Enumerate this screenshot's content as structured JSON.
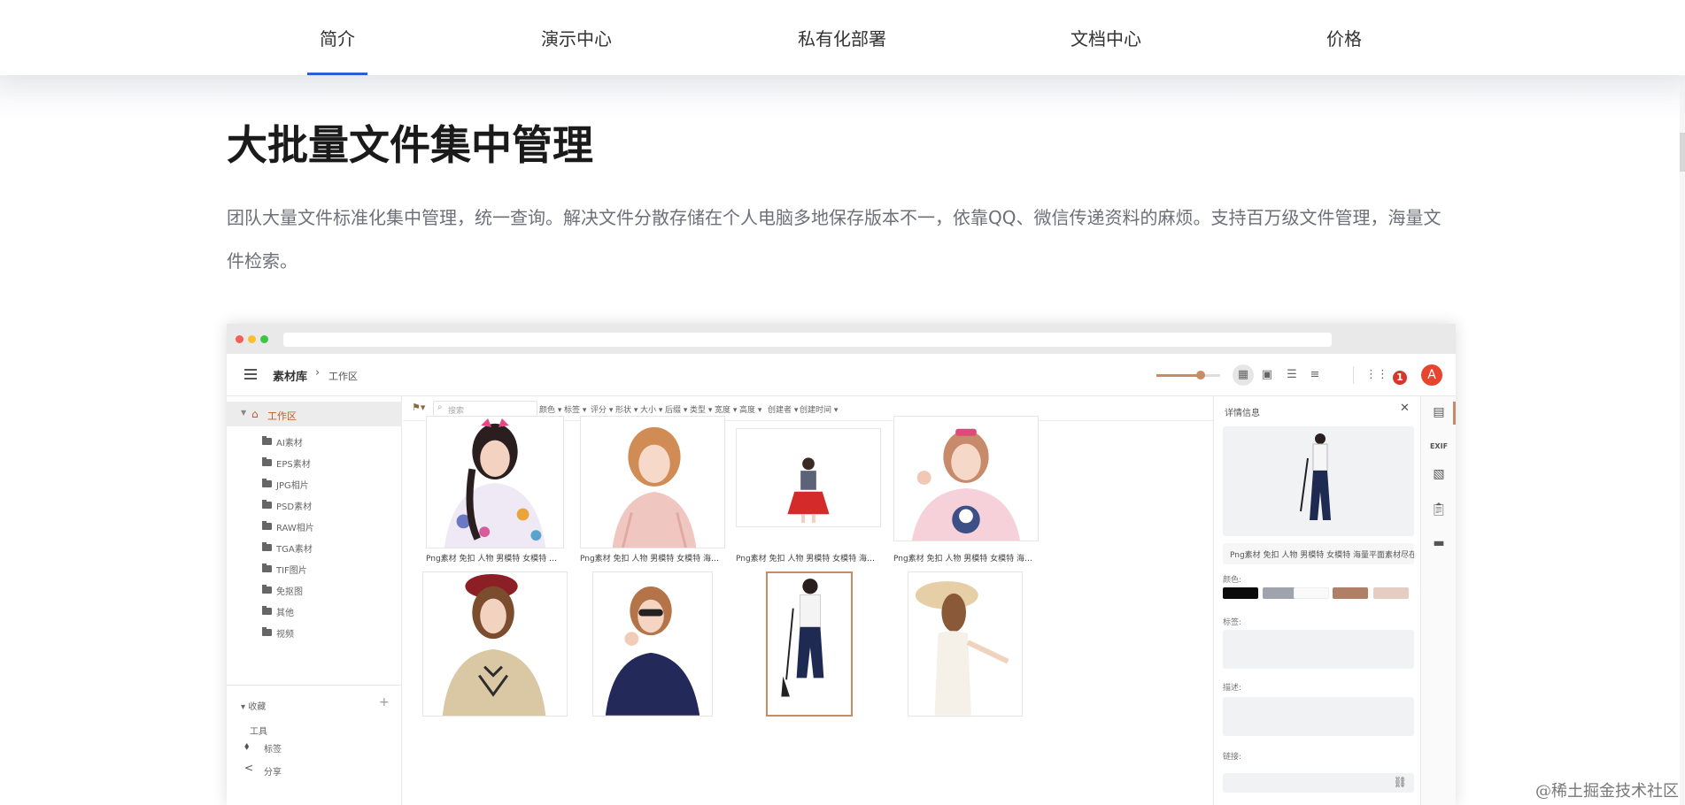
{
  "nav": {
    "items": [
      "简介",
      "演示中心",
      "私有化部署",
      "文档中心",
      "价格"
    ],
    "active_index": 0
  },
  "hero": {
    "title": "大批量文件集中管理",
    "description": "团队大量文件标准化集中管理，统一查询。解决文件分散存储在个人电脑多地保存版本不一，依靠QQ、微信传递资料的麻烦。支持百万级文件管理，海量文件检索。"
  },
  "app": {
    "breadcrumb": {
      "root": "素材库",
      "separator": "›",
      "current": "工作区"
    },
    "notification_count": "1",
    "avatar_initial": "A",
    "thumbnail_size_level": 0.7,
    "sidebar": {
      "root_label": "工作区",
      "folders": [
        "AI素材",
        "EPS素材",
        "JPG相片",
        "PSD素材",
        "RAW相片",
        "TGA素材",
        "TIF图片",
        "免抠图",
        "其他",
        "视频"
      ],
      "favorites_label": "收藏",
      "tools_label": "工具",
      "tag_label": "标签",
      "share_label": "分享"
    },
    "filter_bar": {
      "search_placeholder": "搜索",
      "filters": [
        "颜色",
        "标签",
        "评分",
        "形状",
        "大小",
        "后缀",
        "类型",
        "宽度",
        "高度",
        "创建者",
        "创建时间"
      ]
    },
    "grid": {
      "captions": [
        "Png素材 免扣 人物 男模特 女模特 海量平面素材",
        "Png素材 免扣 人物 男模特 女模特 海量平面素材",
        "Png素材 免扣 人物 男模特 女模特 海量平面素材",
        "Png素材 免扣 人物 男模特 女模特 海量平面素材"
      ]
    },
    "detail": {
      "title": "详情信息",
      "file_name": "Png素材 免扣 人物 男模特 女模特 海量平面素材尽在",
      "color_label": "颜色:",
      "colors": [
        "#0a0a0a",
        "#9ea3ad",
        "#fafafa",
        "#b08066",
        "#e6cdc3"
      ],
      "tag_label": "标签:",
      "desc_label": "描述:",
      "link_label": "链接:"
    },
    "rail": {
      "exif_label": "EXIF"
    }
  },
  "watermark": "@稀土掘金技术社区",
  "accent_colors": {
    "nav_underline": "#2b5fd9",
    "app_accent": "#c98a66",
    "notification": "#d9362b",
    "avatar": "#e8452f"
  }
}
